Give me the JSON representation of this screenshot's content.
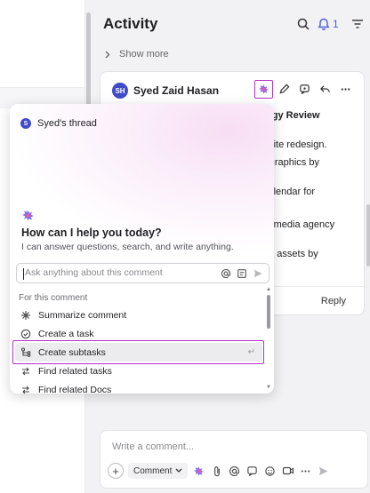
{
  "activity": {
    "title": "Activity",
    "notification_count": "1",
    "show_more": "Show more"
  },
  "comment": {
    "avatar_initials": "SH",
    "author": "Syed Zaid Hasan",
    "text_lines": [
      "tegy Review",
      "bsite redesign.",
      "r graphics by",
      "calendar for",
      "al media agency",
      "gn assets by"
    ],
    "reply_label": "Reply"
  },
  "ai_popup": {
    "thread_initial": "S",
    "thread_title": "Syed's thread",
    "heading": "How can I help you today?",
    "subheading": "I can answer questions, search, and write anything.",
    "ask_placeholder": "Ask anything about this comment",
    "section_label": "For this comment",
    "items": [
      {
        "label": "Summarize comment",
        "icon": "sparkle-icon"
      },
      {
        "label": "Create a task",
        "icon": "task-check-icon"
      },
      {
        "label": "Create subtasks",
        "icon": "subtasks-icon",
        "selected": true
      },
      {
        "label": "Find related tasks",
        "icon": "related-icon"
      },
      {
        "label": "Find related Docs",
        "icon": "related-icon"
      }
    ],
    "return_glyph": "↵"
  },
  "composer": {
    "placeholder": "Write a comment...",
    "plus": "+",
    "comment_type": "Comment"
  },
  "colors": {
    "accent": "#4b5bd6",
    "highlight": "#b531c2",
    "avatar": "#3f4bc9"
  }
}
